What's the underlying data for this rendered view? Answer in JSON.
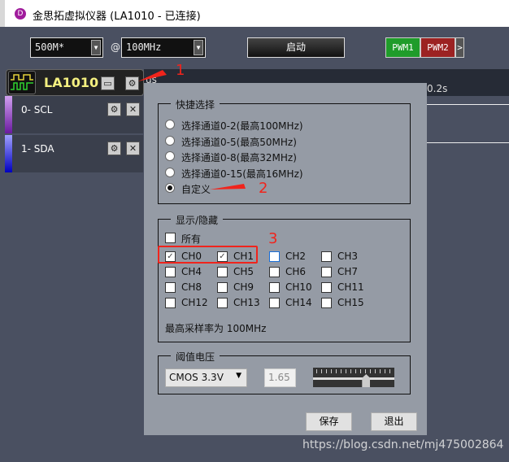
{
  "window": {
    "title": "金思拓虚拟仪器 (LA1010 - 已连接)",
    "logo": "DS"
  },
  "toolbar": {
    "samples": "500M*",
    "at": "@",
    "rate": "100MHz",
    "start": "启动",
    "pwm1": "PWM1",
    "pwm2": "PWM2",
    "more": ">",
    "pwm1_color": "#1f9c2a",
    "pwm2_color": "#9c2222"
  },
  "device": {
    "name": "LA1010",
    "ruler_left": "us",
    "ruler_right": "0.2s"
  },
  "channels": [
    {
      "label": "0-  SCL",
      "color": "#7a1fb8"
    },
    {
      "label": "1-  SDA",
      "color": "#1a1ad0"
    }
  ],
  "dialog": {
    "quick": {
      "title": "快捷选择",
      "options": [
        {
          "label": "选择通道0-2(最高100MHz)",
          "selected": false
        },
        {
          "label": "选择通道0-5(最高50MHz)",
          "selected": false
        },
        {
          "label": "选择通道0-8(最高32MHz)",
          "selected": false
        },
        {
          "label": "选择通道0-15(最高16MHz)",
          "selected": false
        },
        {
          "label": "自定义",
          "selected": true
        }
      ]
    },
    "show": {
      "title": "显示/隐藏",
      "all": "所有",
      "channels": [
        {
          "label": "CH0",
          "checked": true
        },
        {
          "label": "CH1",
          "checked": true
        },
        {
          "label": "CH2",
          "checked": false
        },
        {
          "label": "CH3",
          "checked": false
        },
        {
          "label": "CH4",
          "checked": false
        },
        {
          "label": "CH5",
          "checked": false
        },
        {
          "label": "CH6",
          "checked": false
        },
        {
          "label": "CH7",
          "checked": false
        },
        {
          "label": "CH8",
          "checked": false
        },
        {
          "label": "CH9",
          "checked": false
        },
        {
          "label": "CH10",
          "checked": false
        },
        {
          "label": "CH11",
          "checked": false
        },
        {
          "label": "CH12",
          "checked": false
        },
        {
          "label": "CH13",
          "checked": false
        },
        {
          "label": "CH14",
          "checked": false
        },
        {
          "label": "CH15",
          "checked": false
        }
      ],
      "max_rate": "最高采样率为 100MHz"
    },
    "threshold": {
      "title": "阈值电压",
      "type": "CMOS 3.3V",
      "value": "1.65",
      "slider_fraction": 0.67
    },
    "save": "保存",
    "exit": "退出"
  },
  "annotations": {
    "a1": "1",
    "a2": "2",
    "a3": "3"
  },
  "watermark": "https://blog.csdn.net/mj475002864"
}
